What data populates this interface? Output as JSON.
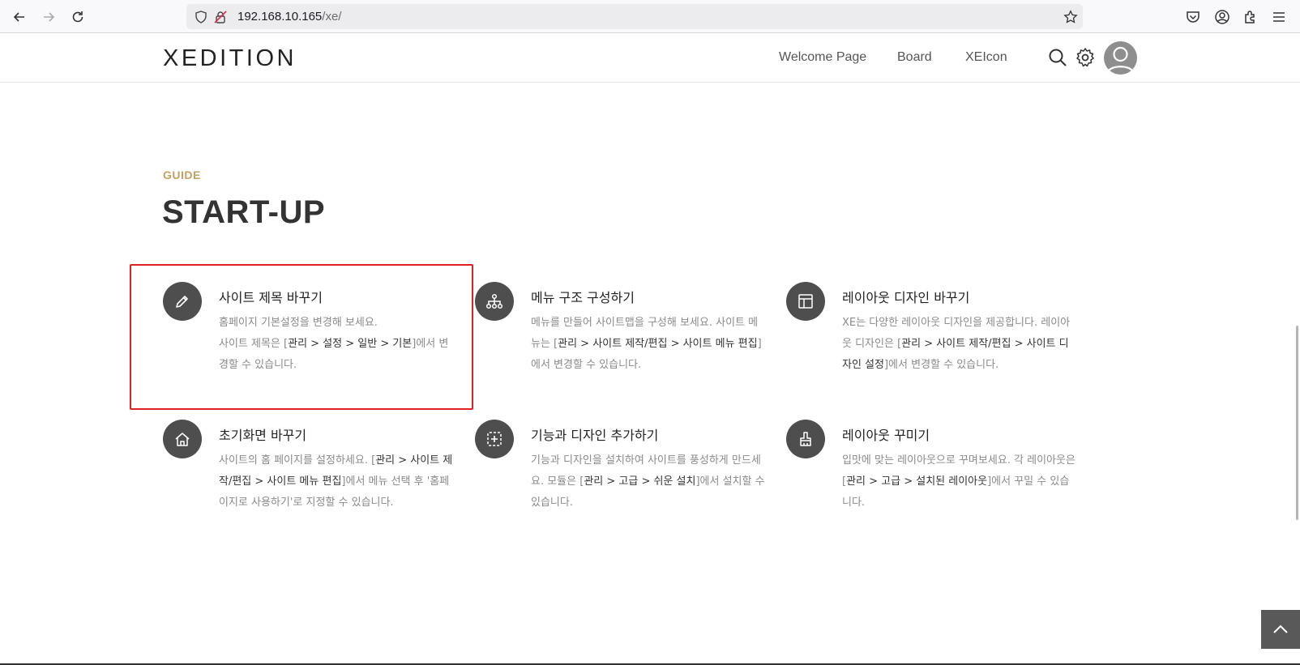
{
  "browser": {
    "url_host": "192.168.10.165",
    "url_path": "/xe/"
  },
  "header": {
    "logo": "XEDITION",
    "nav": [
      "Welcome Page",
      "Board",
      "XEIcon"
    ]
  },
  "section": {
    "eyebrow": "GUIDE",
    "title": "START-UP"
  },
  "cards": [
    {
      "icon": "pencil-icon",
      "title": "사이트 제목 바꾸기",
      "desc": [
        {
          "t": "홈페이지 기본설정을 변경해 보세요."
        },
        {
          "t": "사이트 제목은 ["
        },
        {
          "t": "관리 > 설정 > 일반 > 기본",
          "b": true
        },
        {
          "t": "]에서 변경할 수 있습니다."
        }
      ],
      "breaks_after": [
        0
      ]
    },
    {
      "icon": "sitemap-icon",
      "title": "메뉴 구조 구성하기",
      "desc": [
        {
          "t": "메뉴를 만들어 사이트맵을 구성해 보세요. 사이트 메뉴는 ["
        },
        {
          "t": "관리 > 사이트 제작/편집 > 사이트 메뉴 편집",
          "b": true
        },
        {
          "t": "]에서 변경할 수 있습니다."
        }
      ]
    },
    {
      "icon": "layout-icon",
      "title": "레이아웃 디자인 바꾸기",
      "desc": [
        {
          "t": "XE는 다양한 레이아웃 디자인을 제공합니다. 레이아웃 디자인은 ["
        },
        {
          "t": "관리 > 사이트 제작/편집 > 사이트 디자인 설정",
          "b": true
        },
        {
          "t": "]에서 변경할 수 있습니다."
        }
      ]
    },
    {
      "icon": "home-icon",
      "title": "초기화면 바꾸기",
      "desc": [
        {
          "t": "사이트의 홈 페이지를 설정하세요. ["
        },
        {
          "t": "관리 > 사이트 제작/편집 > 사이트 메뉴 편집",
          "b": true
        },
        {
          "t": "]에서 메뉴 선택 후 '홈페이지로 사용하기'로 지정할 수 있습니다."
        }
      ]
    },
    {
      "icon": "add-box-icon",
      "title": "기능과 디자인 추가하기",
      "desc": [
        {
          "t": "기능과 디자인을 설치하여 사이트를 풍성하게 만드세요. 모듈은 ["
        },
        {
          "t": "관리 > 고급 > 쉬운 설치",
          "b": true
        },
        {
          "t": "]에서 설치할 수 있습니다."
        }
      ]
    },
    {
      "icon": "brush-icon",
      "title": "레이아웃 꾸미기",
      "desc": [
        {
          "t": "입맛에 맞는 레이아웃으로 꾸며보세요. 각 레이아웃은 ["
        },
        {
          "t": "관리 > 고급 > 설치된 레이아웃",
          "b": true
        },
        {
          "t": "]에서 꾸밀 수 있습니다."
        }
      ]
    }
  ]
}
